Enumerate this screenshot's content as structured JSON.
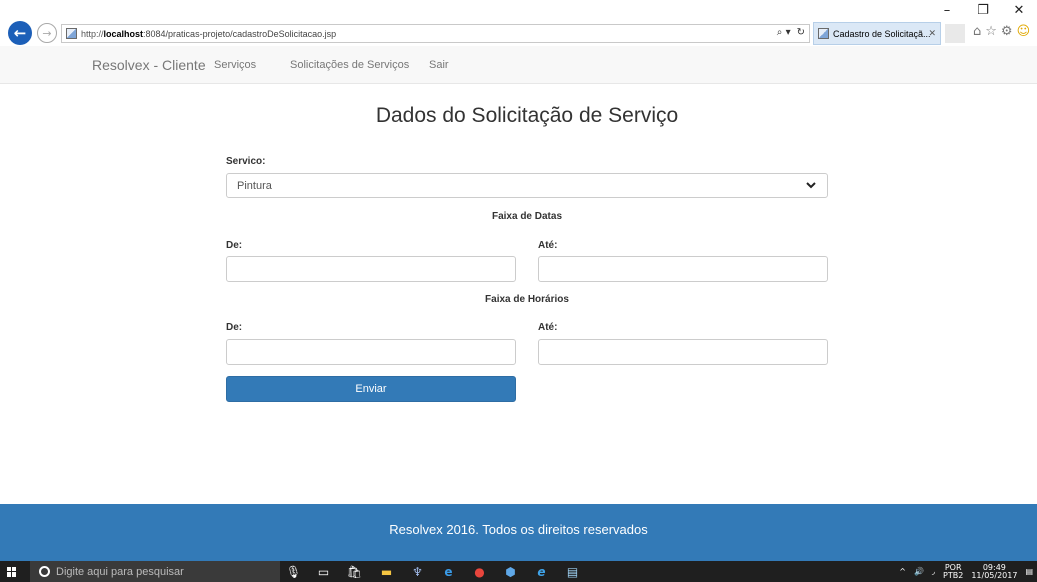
{
  "browser": {
    "url_prefix": "http://",
    "url_host": "localhost",
    "url_rest": ":8084/praticas-projeto/cadastroDeSolicitacao.jsp",
    "tab_title": "Cadastro de Solicitaçã...",
    "search_icon": "⌕ ▾",
    "refresh_icon": "↻",
    "tab_close": "✕",
    "window_controls": [
      "–",
      "❐",
      "✕"
    ],
    "toolbar_icons": [
      "home-icon",
      "favorites-icon",
      "settings-icon",
      "feedback-smiley-icon"
    ]
  },
  "navbar": {
    "brand": "Resolvex - Cliente",
    "links": [
      "Serviços",
      "Solicitações de Serviços",
      "Sair"
    ]
  },
  "form": {
    "title": "Dados do Solicitação de Serviço",
    "service_label": "Servico:",
    "service_value": "Pintura",
    "date_range_heading": "Faixa de Datas",
    "date_from_label": "De:",
    "date_to_label": "Até:",
    "time_range_heading": "Faixa de Horários",
    "time_from_label": "De:",
    "time_to_label": "Até:",
    "submit_label": "Enviar"
  },
  "footer": {
    "text": "Resolvex 2016. Todos os direitos reservados"
  },
  "taskbar": {
    "search_placeholder": "Digite aqui para pesquisar",
    "language_top": "POR",
    "language_bottom": "PTB2",
    "time": "09:49",
    "date": "11/05/2017",
    "pinned_icons": [
      "microphone-icon",
      "task-view-icon",
      "store-icon",
      "file-explorer-icon",
      "network-app-icon",
      "edge-icon",
      "chrome-icon",
      "virtualbox-icon",
      "internet-explorer-icon",
      "notes-icon"
    ]
  },
  "colors": {
    "primary": "#337ab7",
    "navbar_bg": "#f8f8f8",
    "ie_back": "#1c5fb8"
  }
}
